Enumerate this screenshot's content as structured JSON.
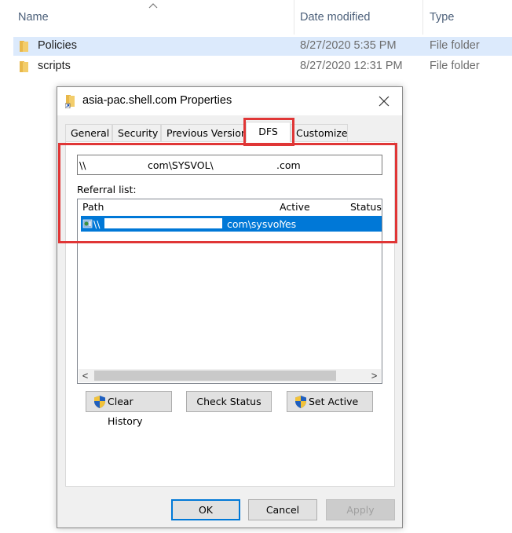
{
  "explorer": {
    "columns": {
      "name": "Name",
      "date_modified": "Date modified",
      "type": "Type"
    },
    "rows": [
      {
        "name": "Policies",
        "date": "8/27/2020 5:35 PM",
        "type": "File folder",
        "selected": true
      },
      {
        "name": "scripts",
        "date": "8/27/2020 12:31 PM",
        "type": "File folder",
        "selected": false
      }
    ]
  },
  "dialog": {
    "title": "asia-pac.shell.com Properties",
    "tabs": [
      "General",
      "Security",
      "Previous Versions",
      "DFS",
      "Customize"
    ],
    "active_tab": "DFS",
    "path": {
      "prefix": "\\\\",
      "middle": "com\\SYSVOL\\",
      "suffix": ".com"
    },
    "referral_label": "Referral list:",
    "list_columns": {
      "path": "Path",
      "active": "Active",
      "status": "Status"
    },
    "referral": {
      "path_prefix": "\\\\",
      "path_suffix": "com\\sysvol",
      "active": "Yes",
      "status": ""
    },
    "buttons": {
      "clear_history": "Clear History",
      "check_status": "Check Status",
      "set_active": "Set Active",
      "ok": "OK",
      "cancel": "Cancel",
      "apply": "Apply"
    },
    "scroll_left": "<",
    "scroll_right": ">"
  },
  "colors": {
    "selection": "#0078d7",
    "row_highlight": "#dceafc",
    "annotation": "#e03636",
    "folder": "#e8b84a"
  }
}
